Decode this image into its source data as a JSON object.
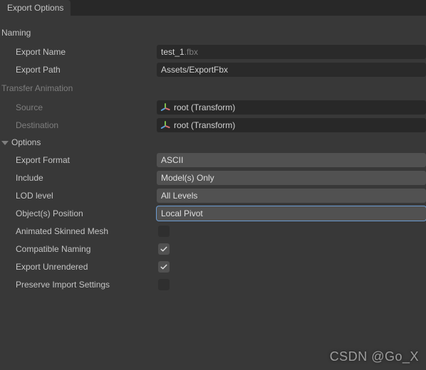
{
  "tab": {
    "title": "Export Options"
  },
  "naming": {
    "header": "Naming",
    "exportName": {
      "label": "Export Name",
      "base": "test_1",
      "ext": ".fbx"
    },
    "exportPath": {
      "label": "Export Path",
      "value": "Assets/ExportFbx"
    }
  },
  "transfer": {
    "header": "Transfer Animation",
    "source": {
      "label": "Source",
      "value": "root (Transform)"
    },
    "destination": {
      "label": "Destination",
      "value": "root (Transform)"
    }
  },
  "options": {
    "header": "Options",
    "exportFormat": {
      "label": "Export Format",
      "value": "ASCII"
    },
    "include": {
      "label": "Include",
      "value": "Model(s) Only"
    },
    "lodLevel": {
      "label": "LOD level",
      "value": "All Levels"
    },
    "objectsPosition": {
      "label": "Object(s) Position",
      "value": "Local Pivot"
    },
    "animSkinned": {
      "label": "Animated Skinned Mesh",
      "checked": false
    },
    "compatNaming": {
      "label": "Compatible Naming",
      "checked": true
    },
    "exportUnrendered": {
      "label": "Export Unrendered",
      "checked": true
    },
    "preserveImport": {
      "label": "Preserve Import Settings",
      "checked": false
    }
  },
  "watermark": "CSDN @Go_X"
}
